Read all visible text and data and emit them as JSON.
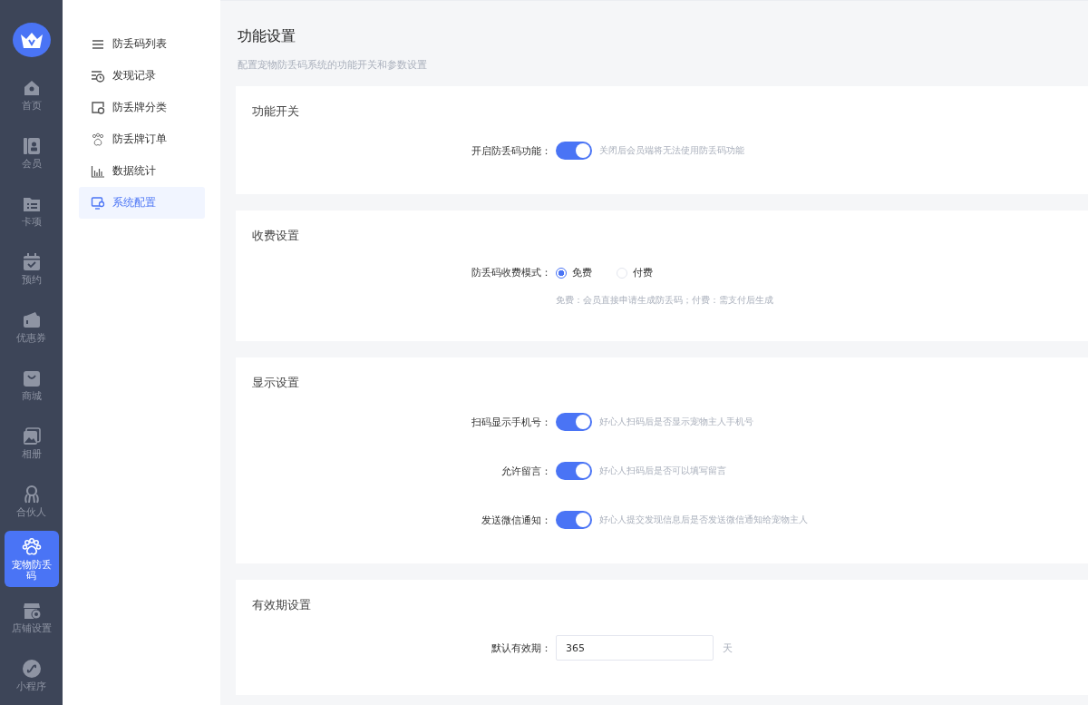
{
  "nav": {
    "items": [
      {
        "label": "首页",
        "selected": false
      },
      {
        "label": "会员",
        "selected": false
      },
      {
        "label": "卡项",
        "selected": false
      },
      {
        "label": "预约",
        "selected": false
      },
      {
        "label": "优惠券",
        "selected": false
      },
      {
        "label": "商城",
        "selected": false
      },
      {
        "label": "相册",
        "selected": false
      },
      {
        "label": "合伙人",
        "selected": false
      },
      {
        "label": "宠物防丢码",
        "selected": true
      },
      {
        "label": "店铺设置",
        "selected": false
      },
      {
        "label": "小程序",
        "selected": false
      }
    ]
  },
  "submenu": {
    "items": [
      {
        "label": "防丢码列表",
        "selected": false
      },
      {
        "label": "发现记录",
        "selected": false
      },
      {
        "label": "防丢牌分类",
        "selected": false
      },
      {
        "label": "防丢牌订单",
        "selected": false
      },
      {
        "label": "数据统计",
        "selected": false
      },
      {
        "label": "系统配置",
        "selected": true
      }
    ]
  },
  "page": {
    "title": "功能设置",
    "subtitle": "配置宠物防丢码系统的功能开关和参数设置"
  },
  "sections": [
    {
      "title": "功能开关",
      "fields": [
        {
          "kind": "switch",
          "label": "开启防丢码功能：",
          "on": true,
          "hint": "关闭后会员端将无法使用防丢码功能"
        }
      ]
    },
    {
      "title": "收费设置",
      "fields": [
        {
          "kind": "radio",
          "label": "防丢码收费模式：",
          "options": [
            {
              "label": "免费",
              "selected": true
            },
            {
              "label": "付费",
              "selected": false
            }
          ],
          "note": "免费：会员直接申请生成防丢码；付费：需支付后生成"
        }
      ]
    },
    {
      "title": "显示设置",
      "fields": [
        {
          "kind": "switch",
          "label": "扫码显示手机号：",
          "on": true,
          "hint": "好心人扫码后是否显示宠物主人手机号"
        },
        {
          "kind": "switch",
          "label": "允许留言：",
          "on": true,
          "hint": "好心人扫码后是否可以填写留言"
        },
        {
          "kind": "switch",
          "label": "发送微信通知：",
          "on": true,
          "hint": "好心人提交发现信息后是否发送微信通知给宠物主人"
        }
      ]
    },
    {
      "title": "有效期设置",
      "fields": [
        {
          "kind": "number",
          "label": "默认有效期：",
          "value": "365",
          "unit": "天"
        }
      ]
    }
  ]
}
